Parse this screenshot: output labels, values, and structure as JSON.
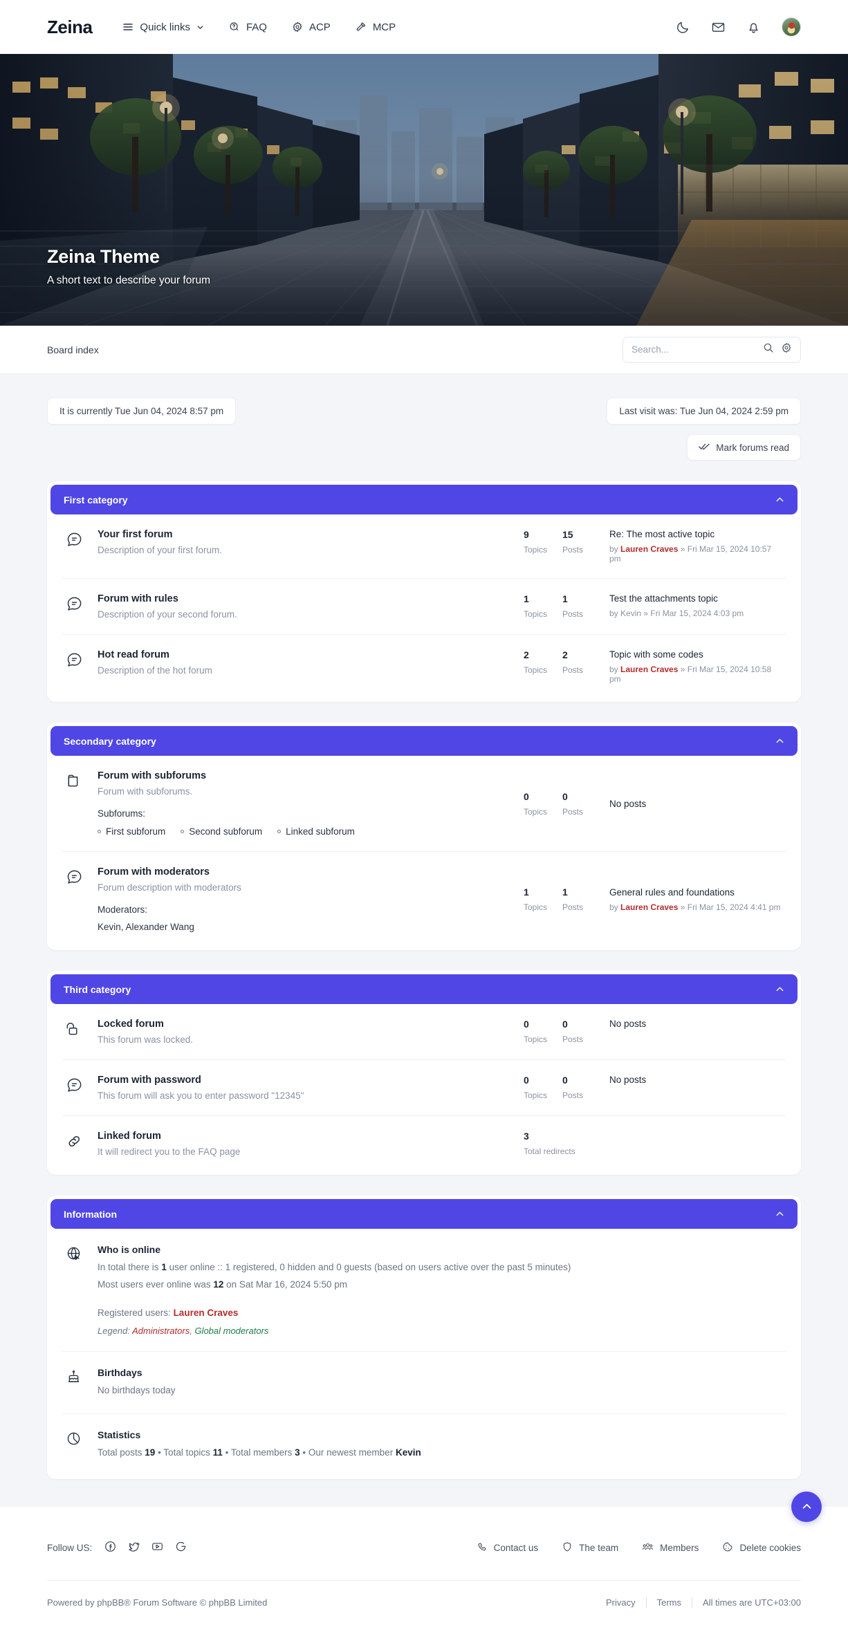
{
  "header": {
    "brand": "Zeina",
    "nav": [
      {
        "label": "Quick links",
        "icon": "menu-icon",
        "caret": true
      },
      {
        "label": "FAQ",
        "icon": "question-bubble-icon",
        "caret": false
      },
      {
        "label": "ACP",
        "icon": "gear-icon",
        "caret": false
      },
      {
        "label": "MCP",
        "icon": "gavel-icon",
        "caret": false
      }
    ],
    "actions": [
      {
        "name": "dark-mode-toggle",
        "icon": "moon-icon"
      },
      {
        "name": "messages-button",
        "icon": "envelope-icon"
      },
      {
        "name": "notifications-button",
        "icon": "bell-icon"
      },
      {
        "name": "user-avatar",
        "icon": "avatar"
      }
    ]
  },
  "hero": {
    "title": "Zeina Theme",
    "subtitle": "A short text to describe your forum"
  },
  "breadcrumb": {
    "items": [
      "Board index"
    ],
    "search": {
      "placeholder": "Search...",
      "value": "",
      "icon": "search-icon",
      "settings_icon": "gear-icon"
    }
  },
  "status": {
    "current_time": "It is currently Tue Jun 04, 2024 8:57 pm",
    "last_visit": "Last visit was: Tue Jun 04, 2024 2:59 pm",
    "mark_forums_read": "Mark forums read"
  },
  "categories": [
    {
      "title": "First category",
      "collapse_icon": "chevron-up-icon",
      "forums": [
        {
          "icon": "forum-unread-icon",
          "title": "Your first forum",
          "description": "Description of your first forum.",
          "topics": "9",
          "topics_label": "Topics",
          "posts": "15",
          "posts_label": "Posts",
          "last_topic": "Re: The most active topic",
          "last_by_prefix": "by ",
          "last_author": "Lauren Craves",
          "last_date": " » Fri Mar 15, 2024 10:57 pm"
        },
        {
          "icon": "forum-unread-icon",
          "title": "Forum with rules",
          "description": "Description of your second forum.",
          "topics": "1",
          "topics_label": "Topics",
          "posts": "1",
          "posts_label": "Posts",
          "last_topic": "Test the attachments topic",
          "last_by_prefix": "by ",
          "last_author": "Kevin",
          "last_date": " » Fri Mar 15, 2024 4:03 pm"
        },
        {
          "icon": "forum-unread-icon",
          "title": "Hot read forum",
          "description": "Description of the hot forum",
          "topics": "2",
          "topics_label": "Topics",
          "posts": "2",
          "posts_label": "Posts",
          "last_topic": "Topic with some codes",
          "last_by_prefix": "by ",
          "last_author": "Lauren Craves",
          "last_date": " » Fri Mar 15, 2024 10:58 pm"
        }
      ]
    },
    {
      "title": "Secondary category",
      "collapse_icon": "chevron-up-icon",
      "forums": [
        {
          "icon": "folder-icon",
          "title": "Forum with subforums",
          "description": "Forum with subforums.",
          "subforums_label": "Subforums:",
          "subforums": [
            "First subforum",
            "Second subforum",
            "Linked subforum"
          ],
          "topics": "0",
          "topics_label": "Topics",
          "posts": "0",
          "posts_label": "Posts",
          "no_posts": "No posts"
        },
        {
          "icon": "forum-unread-icon",
          "title": "Forum with moderators",
          "description": "Forum description with moderators",
          "moderators_label": "Moderators:",
          "moderators": "Kevin,  Alexander Wang",
          "topics": "1",
          "topics_label": "Topics",
          "posts": "1",
          "posts_label": "Posts",
          "last_topic": "General rules and foundations",
          "last_by_prefix": "by ",
          "last_author": "Lauren Craves",
          "last_date": " » Fri Mar 15, 2024 4:41 pm"
        }
      ]
    },
    {
      "title": "Third category",
      "collapse_icon": "chevron-up-icon",
      "forums": [
        {
          "icon": "lock-icon",
          "title": "Locked forum",
          "description": "This forum was locked.",
          "topics": "0",
          "topics_label": "Topics",
          "posts": "0",
          "posts_label": "Posts",
          "no_posts": "No posts"
        },
        {
          "icon": "forum-unread-icon",
          "title": "Forum with password",
          "description": "This forum will ask you to enter password \"12345\"",
          "topics": "0",
          "topics_label": "Topics",
          "posts": "0",
          "posts_label": "Posts",
          "no_posts": "No posts"
        },
        {
          "icon": "link-icon",
          "title": "Linked forum",
          "description": "It will redirect you to the FAQ page",
          "redirects": "3",
          "redirects_label": "Total redirects"
        }
      ]
    }
  ],
  "information": {
    "title": "Information",
    "collapse_icon": "chevron-up-icon",
    "who_is_online": {
      "icon": "globe-icon",
      "title": "Who is online",
      "line1_a": "In total there is ",
      "line1_b": "1",
      "line1_c": " user online :: 1 registered, 0 hidden and 0 guests (based on users active over the past 5 minutes)",
      "line2_a": "Most users ever online was ",
      "line2_b": "12",
      "line2_c": " on Sat Mar 16, 2024 5:50 pm",
      "registered_label": "Registered users: ",
      "registered_users": "Lauren Craves",
      "legend_label": "Legend: ",
      "legend_admins": "Administrators",
      "legend_sep": ", ",
      "legend_gmods": "Global moderators"
    },
    "birthdays": {
      "icon": "cake-icon",
      "title": "Birthdays",
      "text": "No birthdays today"
    },
    "statistics": {
      "icon": "pie-chart-icon",
      "title": "Statistics",
      "posts_label": "Total posts ",
      "posts_value": "19",
      "topics_label": " • Total topics ",
      "topics_value": "11",
      "members_label": " • Total members ",
      "members_value": "3",
      "newest_label": " • Our newest member ",
      "newest_value": "Kevin"
    }
  },
  "footer": {
    "follow_label": "Follow US:",
    "socials": [
      {
        "name": "facebook-icon"
      },
      {
        "name": "twitter-icon"
      },
      {
        "name": "youtube-icon"
      },
      {
        "name": "google-icon"
      }
    ],
    "links": [
      {
        "label": "Contact us",
        "icon": "contact-icon"
      },
      {
        "label": "The team",
        "icon": "shield-icon"
      },
      {
        "label": "Members",
        "icon": "members-icon"
      },
      {
        "label": "Delete cookies",
        "icon": "cookie-icon"
      }
    ],
    "copyright": "Powered by phpBB® Forum Software © phpBB Limited",
    "privacy": "Privacy",
    "terms": "Terms",
    "timezone": "All times are UTC+03:00",
    "to_top_icon": "chevron-up-icon"
  },
  "colors": {
    "accent": "#4f46e5",
    "page_bg": "#f4f5f8",
    "card_bg": "#ffffff",
    "username_red": "#b32c2c",
    "gmod_green": "#1f7a4d",
    "muted_text": "#8a92a1"
  }
}
